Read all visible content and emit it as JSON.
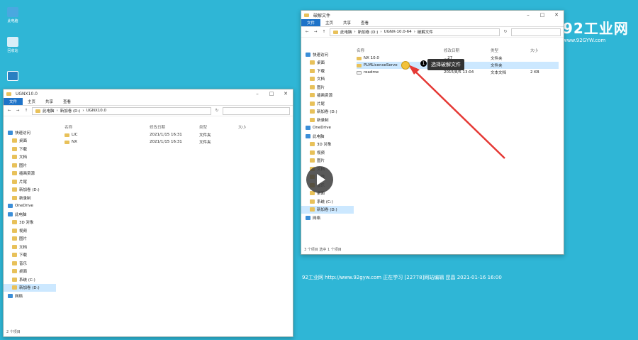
{
  "desktop": {
    "icons": [
      {
        "label": "此电脑"
      },
      {
        "label": "回收站"
      },
      {
        "label": ""
      }
    ]
  },
  "left_window": {
    "title": "UGNX10.0",
    "ribbon": {
      "file": "文件",
      "tabs": [
        "主页",
        "共享",
        "查看"
      ]
    },
    "path": [
      "此电脑",
      "新加卷 (D:)",
      "UGNX10.0"
    ],
    "nav": [
      {
        "label": "快速访问",
        "hd": true
      },
      {
        "label": "桌面"
      },
      {
        "label": "下载"
      },
      {
        "label": "文档"
      },
      {
        "label": "图片"
      },
      {
        "label": "插画资源"
      },
      {
        "label": "片尾"
      },
      {
        "label": "新加卷 (D:)"
      },
      {
        "label": "新录制"
      },
      {
        "label": "OneDrive",
        "hd": true
      },
      {
        "label": "此电脑",
        "hd": true
      },
      {
        "label": "3D 对象"
      },
      {
        "label": "视频"
      },
      {
        "label": "图片"
      },
      {
        "label": "文档"
      },
      {
        "label": "下载"
      },
      {
        "label": "音乐"
      },
      {
        "label": "桌面"
      },
      {
        "label": "系统 (C:)"
      },
      {
        "label": "新加卷 (D:)",
        "sel": true
      },
      {
        "label": "网络",
        "hd": true
      }
    ],
    "columns": [
      "名称",
      "修改日期",
      "类型",
      "大小"
    ],
    "files": [
      {
        "name": "LIC",
        "date": "2021/1/15 16:31",
        "type": "文件夹",
        "size": ""
      },
      {
        "name": "NX",
        "date": "2021/1/15 16:31",
        "type": "文件夹",
        "size": ""
      }
    ],
    "status": "2 个项目"
  },
  "right_window": {
    "title": "破解文件",
    "ribbon": {
      "file": "文件",
      "tabs": [
        "主页",
        "共享",
        "查看"
      ]
    },
    "path": [
      "此电脑",
      "新加卷 (D:)",
      "UGNX-10.0-64",
      "破解文件"
    ],
    "nav": [
      {
        "label": "快速访问",
        "hd": true
      },
      {
        "label": "桌面"
      },
      {
        "label": "下载"
      },
      {
        "label": "文档"
      },
      {
        "label": "图片"
      },
      {
        "label": "插画资源"
      },
      {
        "label": "片尾"
      },
      {
        "label": "新加卷 (D:)"
      },
      {
        "label": "新录制"
      },
      {
        "label": "OneDrive",
        "hd": true
      },
      {
        "label": "此电脑",
        "hd": true
      },
      {
        "label": "3D 对象"
      },
      {
        "label": "视频"
      },
      {
        "label": "图片"
      },
      {
        "label": "文档"
      },
      {
        "label": "下载"
      },
      {
        "label": "音乐"
      },
      {
        "label": "桌面"
      },
      {
        "label": "系统 (C:)"
      },
      {
        "label": "新加卷 (D:)",
        "sel": true
      },
      {
        "label": "网络",
        "hd": true
      }
    ],
    "columns": [
      "名称",
      "修改日期",
      "类型",
      "大小"
    ],
    "files": [
      {
        "name": "NX 10.0",
        "date": "...27",
        "type": "文件夹",
        "size": ""
      },
      {
        "name": "PLMLicenseServe",
        "date": "...40",
        "type": "文件夹",
        "size": "",
        "sel": true
      },
      {
        "name": "readme",
        "date": "2015/8/5 13:04",
        "type": "文本文档",
        "size": "2 KB"
      }
    ],
    "status": "3 个项目    选中 1 个项目"
  },
  "callout": {
    "badge": "1",
    "text": "选择破解文件"
  },
  "watermark": "92工业网 http://www.92gyw.com 正在学习 [22778]网站编辑 昆昌 2021-01-16 16:00",
  "logo": {
    "name": "92工业网",
    "url": "www.92GYW.com"
  },
  "colors": {
    "desktop": "#2fb6d6",
    "accent": "#1e73c8",
    "arrow": "#e53935"
  }
}
